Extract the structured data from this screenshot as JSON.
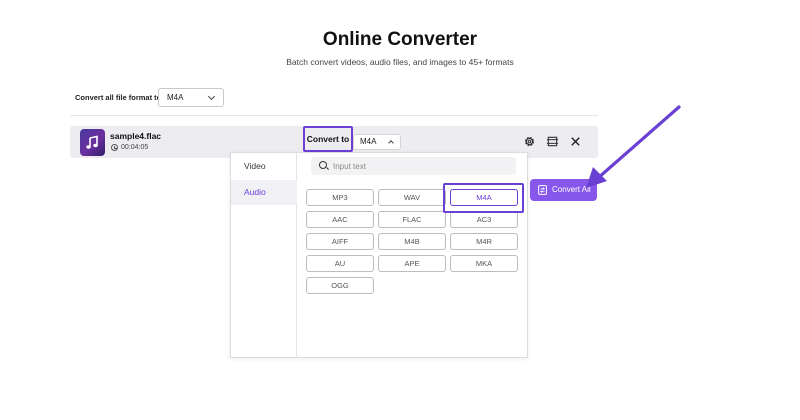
{
  "header": {
    "title": "Online Converter",
    "subtitle": "Batch convert videos, audio files, and images to 45+ formats"
  },
  "global_format": {
    "label": "Convert all file format to:",
    "value": "M4A"
  },
  "file": {
    "name": "sample4.flac",
    "duration": "00:04:05",
    "convert_to_label": "Convert to",
    "format_value": "M4A"
  },
  "dropdown": {
    "tabs": [
      "Video",
      "Audio"
    ],
    "active_tab": "Audio",
    "search_placeholder": "Input text",
    "formats": [
      "MP3",
      "WAV",
      "M4A",
      "AAC",
      "FLAC",
      "AC3",
      "AIFF",
      "M4B",
      "M4R",
      "AU",
      "APE",
      "MKA",
      "OGG"
    ],
    "selected_format": "M4A"
  },
  "actions": {
    "convert_all_label": "Convert All"
  },
  "colors": {
    "accent": "#6a3fd4",
    "button": "#8657ea",
    "row_bg": "#ededf1"
  },
  "icons": [
    "music-note-icon",
    "clock-icon",
    "gear-icon",
    "edit-icon",
    "close-icon",
    "search-icon",
    "convert-icon",
    "arrow-annotation"
  ]
}
